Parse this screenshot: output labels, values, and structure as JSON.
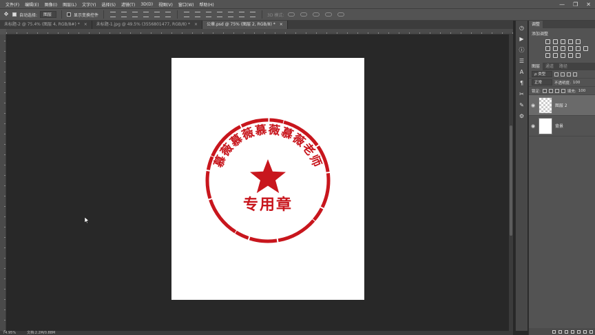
{
  "menu": [
    "文件(F)",
    "编辑(E)",
    "图像(I)",
    "图层(L)",
    "文字(Y)",
    "选择(S)",
    "滤镜(T)",
    "3D(D)",
    "视图(V)",
    "窗口(W)",
    "帮助(H)"
  ],
  "window_controls": {
    "minimize": "—",
    "restore": "❐",
    "close": "✕"
  },
  "options": {
    "auto_select_label": "自动选择:",
    "auto_select_target": "图层",
    "show_transform_label": "显示变换控件",
    "mode_3d_label": "3D 模式:"
  },
  "tabs": [
    {
      "label": "未标题-2 @ 75.4% (图层 4, RGB/8#) *",
      "close": "×"
    },
    {
      "label": "未标题-1.jpg @ 49.5% (3556801477, RGB/8) *",
      "close": "×"
    },
    {
      "label": "公章.psd @ 75% (图层 2, RGB/8) *",
      "close": "×",
      "active": true
    }
  ],
  "stamp": {
    "top_text": "慕薇慕薇慕薇慕薇老师",
    "bottom_text": "专用章",
    "color": "#c8161d"
  },
  "status": {
    "zoom": "74.95%",
    "doc": "文档:2.2M/0.88M"
  },
  "panel": {
    "tabs": [
      "调整"
    ],
    "add_adjustment": "添加调整",
    "layer_tabs": [
      "图层",
      "通道",
      "路径"
    ],
    "kind_filter": "ρ 类型",
    "blend_mode": "正常",
    "opacity_label": "不透明度:",
    "opacity_value": "100",
    "lock_label": "锁定:",
    "fill_label": "填充:",
    "fill_value": "100",
    "layers": [
      {
        "name": "图层 2",
        "active": true
      },
      {
        "name": "背景",
        "active": false
      }
    ]
  },
  "colors": {
    "ui_dark": "#282828",
    "panel": "#535353",
    "stamp_red": "#c8161d"
  }
}
